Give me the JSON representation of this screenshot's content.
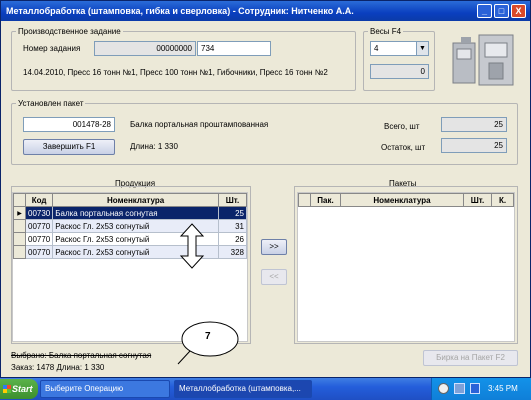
{
  "window": {
    "title": "Металлобработка (штамповка, гибка и сверловка) - Сотрудник: Нитченко А.А.",
    "minimize": "_",
    "maximize": "□",
    "close": "X"
  },
  "job": {
    "legend": "Производственное задание",
    "number_label": "Номер задания",
    "number_value": "00000000",
    "number_suffix": "734",
    "description": "14.04.2010, Пресс 16 тонн №1, Пресс 100 тонн №1, Гибочники, Пресс 16 тонн №2"
  },
  "scales": {
    "legend": "Весы  F4",
    "selected": "4",
    "weight": "0"
  },
  "package": {
    "legend": "Установлен пакет",
    "code": "001478-28",
    "name": "Балка портальная проштампованная",
    "length": "Длина: 1 330",
    "finish_button": "Завершить       F1",
    "total_label": "Всего, шт",
    "total_value": "25",
    "remain_label": "Остаток, шт",
    "remain_value": "25"
  },
  "products": {
    "legend": "Продукция",
    "columns": [
      "Код",
      "Номенклатура",
      "Шт."
    ],
    "rows": [
      {
        "code": "00730",
        "name": "Балка портальная согнутая",
        "qty": "25"
      },
      {
        "code": "00770",
        "name": "Раскос Гл. 2х53 согнутый",
        "qty": "31"
      },
      {
        "code": "00770",
        "name": "Раскос Гл. 2х53 согнутый",
        "qty": "26"
      },
      {
        "code": "00770",
        "name": "Раскос Гл. 2х53 согнутый",
        "qty": "328"
      }
    ]
  },
  "packets": {
    "legend": "Пакеты",
    "columns": [
      "Пак.",
      "Номенклатура",
      "Шт.",
      "К."
    ]
  },
  "move": {
    "right": ">>",
    "left": "<<"
  },
  "annotation": {
    "number": "7"
  },
  "footer": {
    "selected": "Выбрано: Балка портальная согнутая",
    "order": "Заказ: 1478  Длина: 1 330",
    "tag_button": "Бирка на Пакет  F2"
  },
  "taskbar": {
    "start": "Start",
    "tasks": [
      "Выберите Операцию",
      "Металлобработка (штамповка,..."
    ],
    "time": "3:45 PM"
  }
}
